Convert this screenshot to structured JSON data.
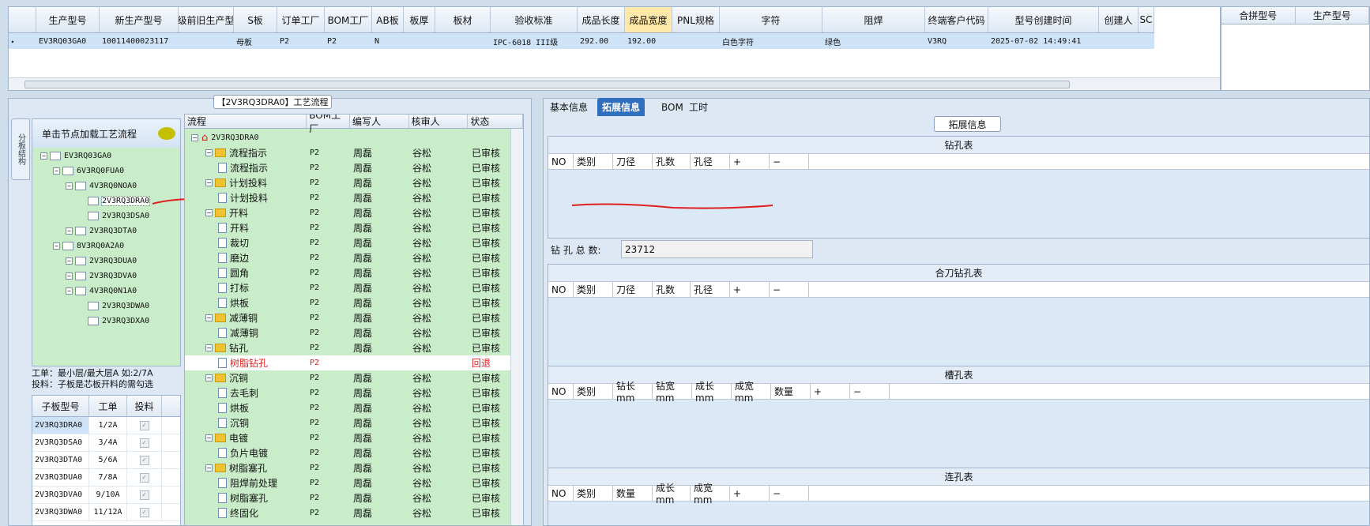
{
  "top_grid": {
    "columns": [
      "生产型号",
      "新生产型号",
      "升级前旧生产型号",
      "S板",
      "订单工厂",
      "BOM工厂",
      "AB板",
      "板厚",
      "板材",
      "验收标准",
      "成品长度",
      "成品宽度",
      "PNL规格",
      "字符",
      "阻焊",
      "终端客户代码",
      "型号创建时间",
      "创建人",
      "SC"
    ],
    "row": [
      "EV3RQ03GA0",
      "10011400023117",
      "",
      "母板",
      "P2",
      "P2",
      "N",
      "",
      "",
      "IPC-6018 III级",
      "292.00",
      "192.00",
      "",
      "白色字符",
      "绿色",
      "V3RQ",
      "2025-07-02 14:49:41",
      "",
      ""
    ]
  },
  "side_grid": {
    "columns": [
      "合拼型号",
      "生产型号"
    ]
  },
  "left_panel": {
    "title": "【2V3RQ3DRA0】工艺流程",
    "vertical_tab": "分板结构",
    "tree_header": "单击节点加载工艺流程",
    "tree_nodes": [
      "EV3RQ03GA0",
      "6V3RQ0FUA0",
      "4V3RQ0NOA0",
      "2V3RQ3DRA0",
      "2V3RQ3DSA0",
      "2V3RQ3DTA0",
      "8V3RQ0A2A0",
      "2V3RQ3DUA0",
      "2V3RQ3DVA0",
      "4V3RQ0N1A0",
      "2V3RQ3DWA0",
      "2V3RQ3DXA0"
    ],
    "note_line1": "工单：最小层/最大层A 如:2/7A",
    "note_line2": "投料：子板是芯板开料的需勾选",
    "sub_table": {
      "columns": [
        "子板型号",
        "工单",
        "投料"
      ],
      "rows": [
        [
          "2V3RQ3DRA0",
          "1/2A",
          "✓"
        ],
        [
          "2V3RQ3DSA0",
          "3/4A",
          "✓"
        ],
        [
          "2V3RQ3DTA0",
          "5/6A",
          "✓"
        ],
        [
          "2V3RQ3DUA0",
          "7/8A",
          "✓"
        ],
        [
          "2V3RQ3DVA0",
          "9/10A",
          "✓"
        ],
        [
          "2V3RQ3DWA0",
          "11/12A",
          "✓"
        ]
      ]
    }
  },
  "flow": {
    "columns": [
      "流程",
      "BOM工厂",
      "编写人",
      "核审人",
      "状态"
    ],
    "root": "2V3RQ3DRA0",
    "rows": [
      {
        "name": "流程指示",
        "factory": "P2",
        "writer": "周磊",
        "reviewer": "谷松",
        "status": "已审核",
        "folder": true
      },
      {
        "name": "流程指示",
        "factory": "P2",
        "writer": "周磊",
        "reviewer": "谷松",
        "status": "已审核",
        "folder": false
      },
      {
        "name": "计划投料",
        "factory": "P2",
        "writer": "周磊",
        "reviewer": "谷松",
        "status": "已审核",
        "folder": true
      },
      {
        "name": "计划投料",
        "factory": "P2",
        "writer": "周磊",
        "reviewer": "谷松",
        "status": "已审核",
        "folder": false
      },
      {
        "name": "开料",
        "factory": "P2",
        "writer": "周磊",
        "reviewer": "谷松",
        "status": "已审核",
        "folder": true
      },
      {
        "name": "开料",
        "factory": "P2",
        "writer": "周磊",
        "reviewer": "谷松",
        "status": "已审核",
        "folder": false
      },
      {
        "name": "裁切",
        "factory": "P2",
        "writer": "周磊",
        "reviewer": "谷松",
        "status": "已审核",
        "folder": false
      },
      {
        "name": "磨边",
        "factory": "P2",
        "writer": "周磊",
        "reviewer": "谷松",
        "status": "已审核",
        "folder": false
      },
      {
        "name": "圆角",
        "factory": "P2",
        "writer": "周磊",
        "reviewer": "谷松",
        "status": "已审核",
        "folder": false
      },
      {
        "name": "打标",
        "factory": "P2",
        "writer": "周磊",
        "reviewer": "谷松",
        "status": "已审核",
        "folder": false
      },
      {
        "name": "烘板",
        "factory": "P2",
        "writer": "周磊",
        "reviewer": "谷松",
        "status": "已审核",
        "folder": false
      },
      {
        "name": "减薄铜",
        "factory": "P2",
        "writer": "周磊",
        "reviewer": "谷松",
        "status": "已审核",
        "folder": true
      },
      {
        "name": "减薄铜",
        "factory": "P2",
        "writer": "周磊",
        "reviewer": "谷松",
        "status": "已审核",
        "folder": false
      },
      {
        "name": "钻孔",
        "factory": "P2",
        "writer": "周磊",
        "reviewer": "谷松",
        "status": "已审核",
        "folder": true
      },
      {
        "name": "树脂钻孔",
        "factory": "P2",
        "writer": "",
        "reviewer": "",
        "status": "回退",
        "folder": false,
        "red": true
      },
      {
        "name": "沉铜",
        "factory": "P2",
        "writer": "周磊",
        "reviewer": "谷松",
        "status": "已审核",
        "folder": true
      },
      {
        "name": "去毛刺",
        "factory": "P2",
        "writer": "周磊",
        "reviewer": "谷松",
        "status": "已审核",
        "folder": false
      },
      {
        "name": "烘板",
        "factory": "P2",
        "writer": "周磊",
        "reviewer": "谷松",
        "status": "已审核",
        "folder": false
      },
      {
        "name": "沉铜",
        "factory": "P2",
        "writer": "周磊",
        "reviewer": "谷松",
        "status": "已审核",
        "folder": false
      },
      {
        "name": "电镀",
        "factory": "P2",
        "writer": "周磊",
        "reviewer": "谷松",
        "status": "已审核",
        "folder": true
      },
      {
        "name": "负片电镀",
        "factory": "P2",
        "writer": "周磊",
        "reviewer": "谷松",
        "status": "已审核",
        "folder": false
      },
      {
        "name": "树脂塞孔",
        "factory": "P2",
        "writer": "周磊",
        "reviewer": "谷松",
        "status": "已审核",
        "folder": true
      },
      {
        "name": "阻焊前处理",
        "factory": "P2",
        "writer": "周磊",
        "reviewer": "谷松",
        "status": "已审核",
        "folder": false
      },
      {
        "name": "树脂塞孔",
        "factory": "P2",
        "writer": "周磊",
        "reviewer": "谷松",
        "status": "已审核",
        "folder": false
      },
      {
        "name": "终固化",
        "factory": "P2",
        "writer": "周磊",
        "reviewer": "谷松",
        "status": "已审核",
        "folder": false
      }
    ]
  },
  "right_panel": {
    "tabs": [
      "基本信息",
      "拓展信息",
      "BOM",
      "工时"
    ],
    "active_tab": "拓展信息",
    "info_label": "拓展信息",
    "drill": {
      "title": "钻孔表",
      "columns": [
        "NO",
        "类别",
        "刀径",
        "孔数",
        "孔径",
        "+",
        "−"
      ]
    },
    "drill_total_label": "钻 孔 总 数:",
    "drill_total_value": "23712",
    "combined": {
      "title": "合刀钻孔表",
      "columns": [
        "NO",
        "类别",
        "刀径",
        "孔数",
        "孔径",
        "+",
        "−"
      ]
    },
    "slot": {
      "title": "槽孔表",
      "columns": [
        "NO",
        "类别",
        "钻长mm",
        "钻宽mm",
        "成长mm",
        "成宽mm",
        "数量",
        "+",
        "−"
      ]
    },
    "link": {
      "title": "连孔表",
      "columns": [
        "NO",
        "类别",
        "数量",
        "成长mm",
        "成宽mm",
        "+",
        "−"
      ]
    }
  }
}
